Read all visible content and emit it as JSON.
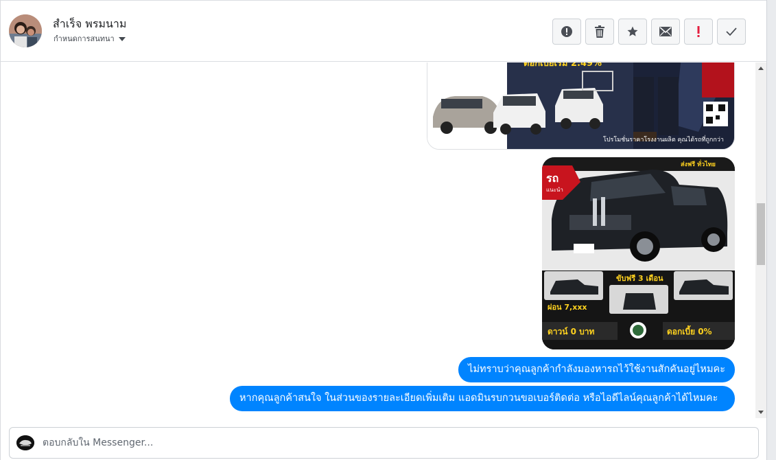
{
  "header": {
    "contact_name": "สำเร็จ พรมนาม",
    "assign_label": "กำหนดการสนทนา"
  },
  "actions": [
    {
      "name": "spam-button",
      "icon": "alert-circle-icon",
      "glyph": "!"
    },
    {
      "name": "delete-button",
      "icon": "trash-icon",
      "glyph": "🗑"
    },
    {
      "name": "star-button",
      "icon": "star-icon",
      "glyph": "★"
    },
    {
      "name": "mark-unread-button",
      "icon": "envelope-icon",
      "glyph": "✉"
    },
    {
      "name": "follow-up-button",
      "icon": "exclamation-icon",
      "glyph": "!"
    },
    {
      "name": "done-button",
      "icon": "check-icon",
      "glyph": "✓"
    }
  ],
  "images": {
    "promo": {
      "rate_text": "ดอกเบี้ยเริ่ม 2.49%",
      "caption": "โปรโมชั่นราคาโรงงานผลิต คุณได้รถที่ถูกกว่า"
    },
    "car_ad": {
      "badge": "ส่งฟรี ทั่วไทย",
      "logo_text": "รถ",
      "logo_sub": "แนะนำ",
      "drive_free": "ขับฟรี 3 เดือน",
      "installment": "ผ่อน 7,xxx",
      "down": "ดาวน์ 0 บาท",
      "interest": "ดอกเบี้ย 0%"
    }
  },
  "messages": [
    "ไม่ทราบว่าคุณลูกค้ากำลังมองหารถไว้ใช้งานสักคันอยู่ไหมคะ",
    "หากคุณลูกค้าสนใจ ในส่วนของรายละเอียดเพิ่มเติม แอดมินรบกวนขอเบอร์ติดต่อ หรือไอดีไลน์คุณลูกค้าได้ไหมคะ"
  ],
  "composer": {
    "placeholder": "ตอบกลับใน Messenger..."
  },
  "colors": {
    "bubble": "#0084ff",
    "accent_red": "#e41e3f"
  }
}
